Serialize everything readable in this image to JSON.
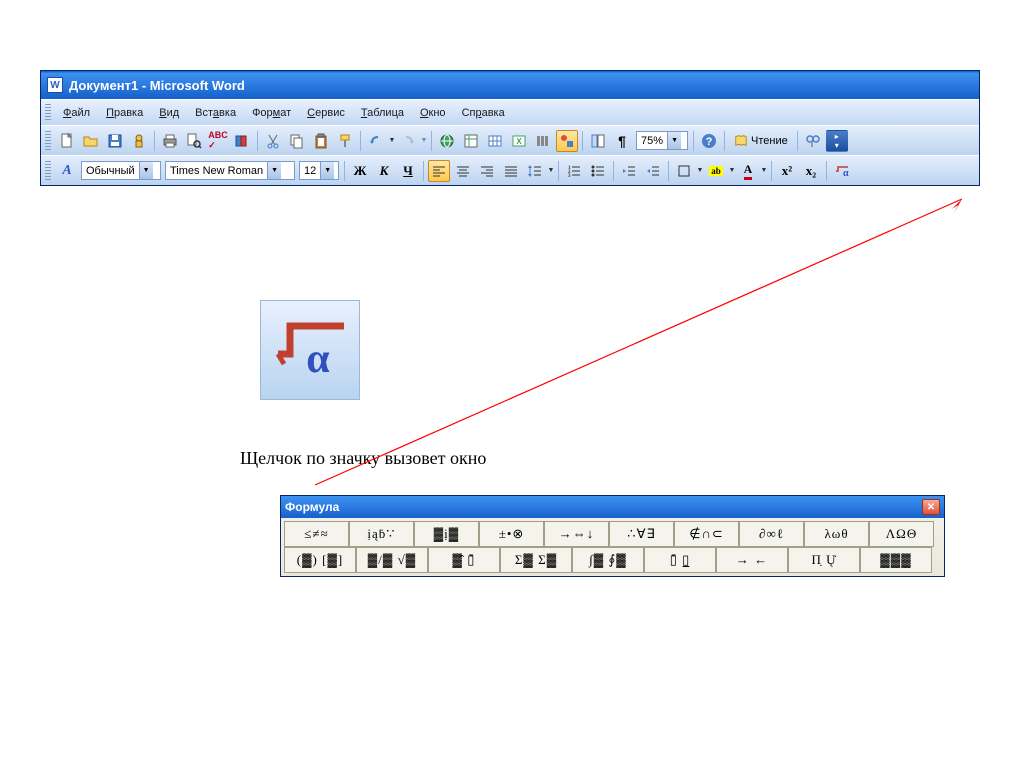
{
  "window": {
    "title": "Документ1 - Microsoft Word",
    "app_icon_label": "W"
  },
  "menu": [
    {
      "label": "Файл",
      "accel": "Ф"
    },
    {
      "label": "Правка",
      "accel": "П"
    },
    {
      "label": "Вид",
      "accel": "В"
    },
    {
      "label": "Вставка",
      "accel": "а"
    },
    {
      "label": "Формат",
      "accel": "м"
    },
    {
      "label": "Сервис",
      "accel": "С"
    },
    {
      "label": "Таблица",
      "accel": "Т"
    },
    {
      "label": "Окно",
      "accel": "О"
    },
    {
      "label": "Справка",
      "accel": "р"
    }
  ],
  "standard_toolbar": {
    "zoom_value": "75%",
    "read_mode_label": "Чтение"
  },
  "format_toolbar": {
    "style": "Обычный",
    "font": "Times New Roman",
    "size": "12",
    "bold": "Ж",
    "italic": "К",
    "underline": "Ч",
    "superscript": "x²",
    "subscript": "x₂"
  },
  "caption": "Щелчок по значку вызовет окно",
  "formula_window": {
    "title": "Формула",
    "row1": [
      "≤≠≈",
      "ịąḃ∵",
      "▓ị▓",
      "±•⊗",
      "→⇔↓",
      "∴∀∃",
      "∉∩⊂",
      "∂∞ℓ",
      "λωθ",
      "ΛΩΘ"
    ],
    "row2": [
      "(▓) [▓]",
      "▓/▓ √▓",
      "▓̂ ▯̄",
      "Σ▓ Σ▓",
      "∫▓ ∮▓",
      "▯̄ ▯̲",
      "→ ←",
      "Π̣ Ų̇",
      "▓▓▓"
    ]
  }
}
